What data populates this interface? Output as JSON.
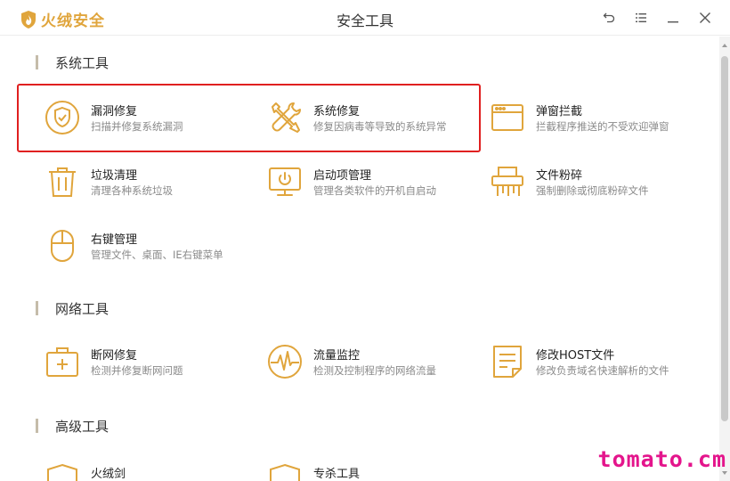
{
  "app": {
    "brand_name": "火绒安全",
    "window_title": "安全工具"
  },
  "colors": {
    "accent": "#e0a53c",
    "highlight": "#e02020",
    "watermark": "#e4158c"
  },
  "window_controls": [
    {
      "name": "back-icon"
    },
    {
      "name": "menu-icon"
    },
    {
      "name": "minimize-icon"
    },
    {
      "name": "close-icon"
    }
  ],
  "sections": {
    "system": {
      "title": "系统工具",
      "tools": [
        {
          "name": "漏洞修复",
          "desc": "扫描并修复系统漏洞",
          "icon": "shield-cycle-icon"
        },
        {
          "name": "系统修复",
          "desc": "修复因病毒等导致的系统异常",
          "icon": "wrench-screwdriver-icon"
        },
        {
          "name": "弹窗拦截",
          "desc": "拦截程序推送的不受欢迎弹窗",
          "icon": "popup-window-icon"
        },
        {
          "name": "垃圾清理",
          "desc": "清理各种系统垃圾",
          "icon": "trash-icon"
        },
        {
          "name": "启动项管理",
          "desc": "管理各类软件的开机自启动",
          "icon": "monitor-power-icon"
        },
        {
          "name": "文件粉碎",
          "desc": "强制删除或彻底粉碎文件",
          "icon": "shredder-icon"
        },
        {
          "name": "右键管理",
          "desc": "管理文件、桌面、IE右键菜单",
          "icon": "mouse-icon"
        }
      ]
    },
    "network": {
      "title": "网络工具",
      "tools": [
        {
          "name": "断网修复",
          "desc": "检测并修复断网问题",
          "icon": "first-aid-kit-icon"
        },
        {
          "name": "流量监控",
          "desc": "检测及控制程序的网络流量",
          "icon": "pulse-icon"
        },
        {
          "name": "修改HOST文件",
          "desc": "修改负责域名快速解析的文件",
          "icon": "document-edit-icon"
        }
      ]
    },
    "advanced": {
      "title": "高级工具",
      "tools": [
        {
          "name": "火绒剑",
          "icon": "shield-icon"
        },
        {
          "name": "专杀工具",
          "icon": "shield-icon"
        }
      ]
    }
  },
  "watermark": "tomato.cm"
}
